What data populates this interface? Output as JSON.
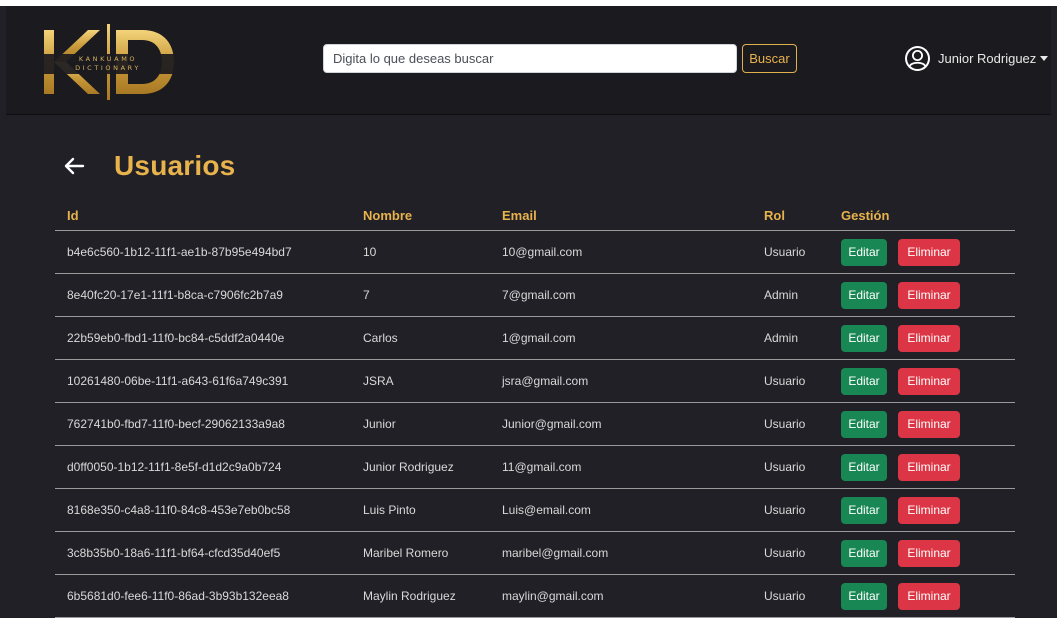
{
  "brand": {
    "initials": "KD",
    "line1": "KANKUAMO",
    "line2": "DICTIONARY"
  },
  "search": {
    "placeholder": "Digita lo que deseas buscar",
    "value": "",
    "button_label": "Buscar"
  },
  "user": {
    "name": "Junior Rodriguez"
  },
  "page": {
    "title": "Usuarios"
  },
  "table": {
    "headers": [
      "Id",
      "Nombre",
      "Email",
      "Rol",
      "Gestión"
    ],
    "edit_label": "Editar",
    "delete_label": "Eliminar",
    "rows": [
      {
        "id": "b4e6c560-1b12-11f1-ae1b-87b95e494bd7",
        "nombre": "10",
        "email": "10@gmail.com",
        "rol": "Usuario"
      },
      {
        "id": "8e40fc20-17e1-11f1-b8ca-c7906fc2b7a9",
        "nombre": "7",
        "email": "7@gmail.com",
        "rol": "Admin"
      },
      {
        "id": "22b59eb0-fbd1-11f0-bc84-c5ddf2a0440e",
        "nombre": "Carlos",
        "email": "1@gmail.com",
        "rol": "Admin"
      },
      {
        "id": "10261480-06be-11f1-a643-61f6a749c391",
        "nombre": "JSRA",
        "email": "jsra@gmail.com",
        "rol": "Usuario"
      },
      {
        "id": "762741b0-fbd7-11f0-becf-29062133a9a8",
        "nombre": "Junior",
        "email": "Junior@gmail.com",
        "rol": "Usuario"
      },
      {
        "id": "d0ff0050-1b12-11f1-8e5f-d1d2c9a0b724",
        "nombre": "Junior Rodriguez",
        "email": "11@gmail.com",
        "rol": "Usuario"
      },
      {
        "id": "8168e350-c4a8-11f0-84c8-453e7eb0bc58",
        "nombre": "Luis Pinto",
        "email": "Luis@email.com",
        "rol": "Usuario"
      },
      {
        "id": "3c8b35b0-18a6-11f1-bf64-cfcd35d40ef5",
        "nombre": "Maribel Romero",
        "email": "maribel@gmail.com",
        "rol": "Usuario"
      },
      {
        "id": "6b5681d0-fee6-11f0-86ad-3b93b132eea8",
        "nombre": "Maylin Rodriguez",
        "email": "maylin@gmail.com",
        "rol": "Usuario"
      }
    ]
  },
  "icons": {
    "back": "arrow-left-icon",
    "avatar": "user-circle-icon",
    "caret": "caret-down-icon"
  },
  "colors": {
    "accent": "#e8b24c",
    "background": "#212026",
    "navbar": "#1b1a1f",
    "edit": "#198754",
    "delete": "#dc3545"
  }
}
